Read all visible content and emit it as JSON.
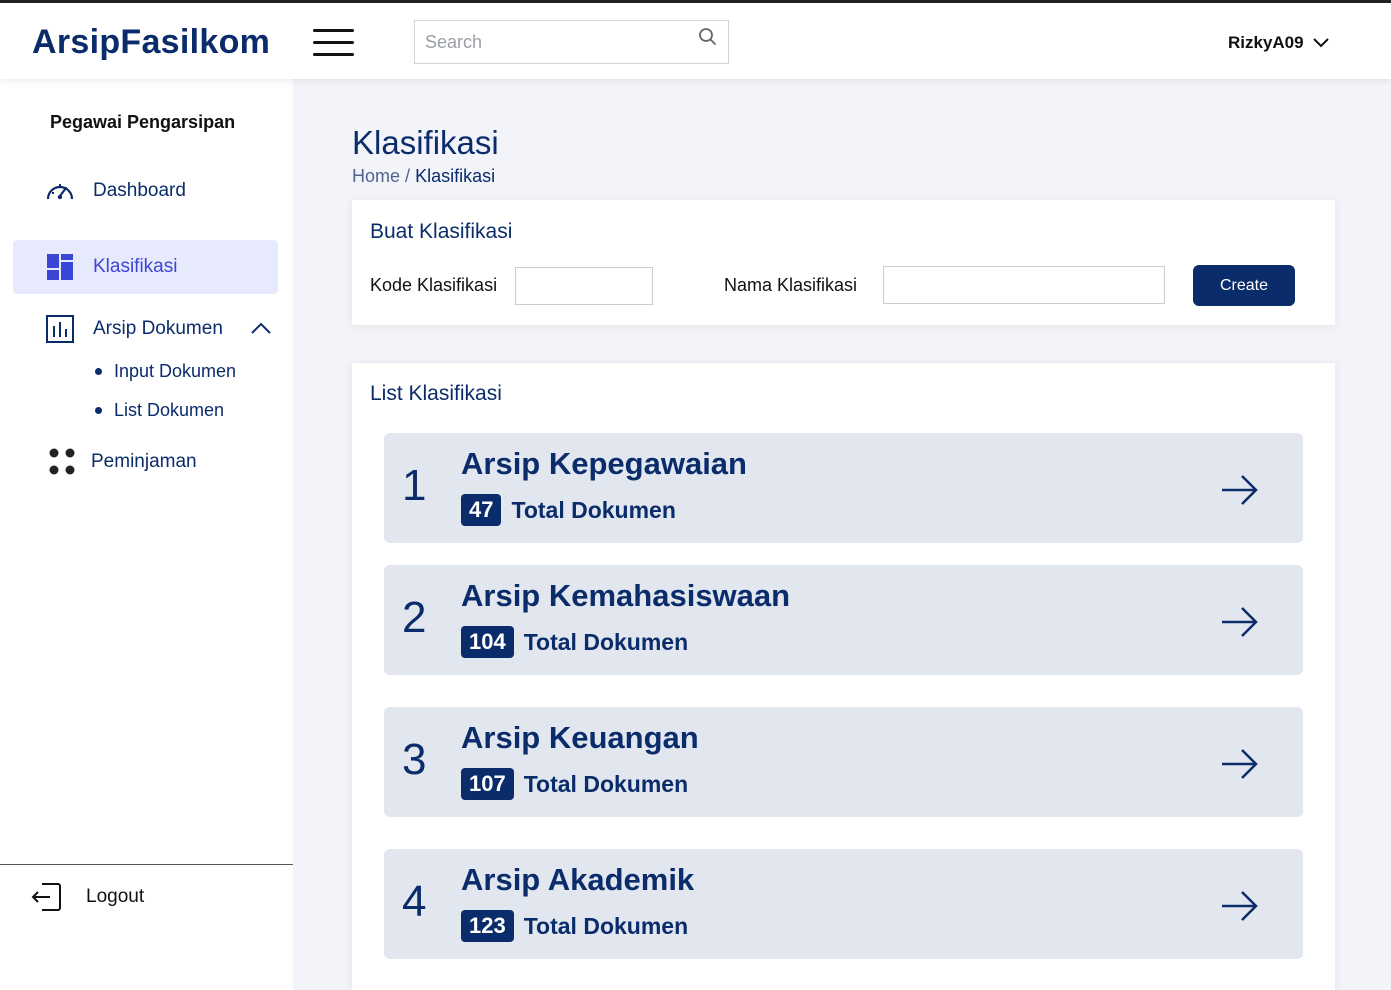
{
  "app": {
    "brand": "ArsipFasilkom"
  },
  "search": {
    "placeholder": "Search"
  },
  "user": {
    "name": "RizkyA09"
  },
  "sidebar": {
    "role": "Pegawai Pengarsipan",
    "items": [
      {
        "label": "Dashboard",
        "icon": "gauge-icon"
      },
      {
        "label": "Klasifikasi",
        "icon": "grid-icon",
        "active": true
      },
      {
        "label": "Arsip Dokumen",
        "icon": "bar-chart-icon",
        "expanded": true,
        "children": [
          {
            "label": "Input Dokumen"
          },
          {
            "label": "List Dokumen"
          }
        ]
      },
      {
        "label": "Peminjaman",
        "icon": "dots-icon"
      }
    ],
    "logout": "Logout"
  },
  "page": {
    "title": "Klasifikasi",
    "breadcrumb": {
      "home": "Home",
      "separator": "/",
      "current": "Klasifikasi"
    }
  },
  "create_form": {
    "title": "Buat Klasifikasi",
    "kode_label": "Kode Klasifikasi",
    "kode_value": "",
    "nama_label": "Nama Klasifikasi",
    "nama_value": "",
    "submit_label": "Create"
  },
  "list": {
    "title": "List Klasifikasi",
    "count_suffix": "Total Dokumen",
    "items": [
      {
        "number": "1",
        "name": "Arsip Kepegawaian",
        "count": "47"
      },
      {
        "number": "2",
        "name": "Arsip Kemahasiswaan",
        "count": "104"
      },
      {
        "number": "3",
        "name": "Arsip Keuangan",
        "count": "107"
      },
      {
        "number": "4",
        "name": "Arsip Akademik",
        "count": "123"
      }
    ]
  },
  "colors": {
    "primary": "#0b2c6b",
    "active_bg": "#e7eafc",
    "active_text": "#3b46d6",
    "item_bg": "#e2e6ef",
    "page_bg": "#f2f4f9"
  }
}
